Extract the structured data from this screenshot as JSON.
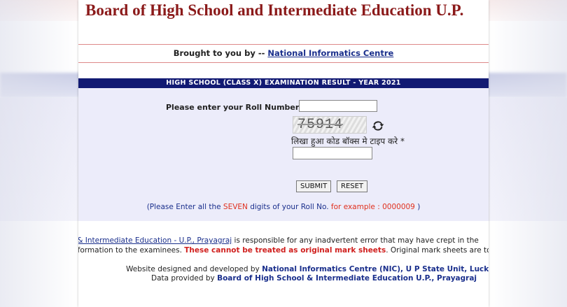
{
  "header": {
    "title": "Board of High School and Intermediate Education U.P."
  },
  "credit": {
    "prefix": "Brought to you by -- ",
    "link": "National Informatics Centre"
  },
  "banner": {
    "text": "HIGH SCHOOL (CLASS X)  EXAMINATION RESULT - YEAR 2021"
  },
  "form": {
    "roll_label": "Please enter your Roll Number",
    "roll_value": "",
    "captcha_code": "75914",
    "captcha_label": "लिखा हुआ कोड बॉक्स मे टाइप करे *",
    "captcha_value": "",
    "submit_label": "SUBMIT",
    "reset_label": "RESET"
  },
  "note": {
    "p1": "(Please Enter all the ",
    "p2": "SEVEN",
    "p3": " digits of your Roll No. ",
    "p4": "for example : 0000009",
    "p5": " )"
  },
  "disclaimer": {
    "line1_link": "l & Intermediate Education - U.P., Prayagraj",
    "line1_text": " is responsible for any inadvertent error that may have crept in the",
    "line2_a": "nformation to the examinees. ",
    "line2_red": "These cannot be treated as original mark sheets",
    "line2_b": ". Original mark sheets are to be"
  },
  "footer": {
    "line1_prefix": "Website designed and developed by ",
    "line1_bold": "National Informatics Centre (NIC), U P State Unit, Lucknow",
    "line2_prefix": "Data provided by ",
    "line2_bold": "Board of High School & Intermediate Education U.P., Prayagraj"
  },
  "colors": {
    "title": "#8b1a1a",
    "banner_bg": "#121a73",
    "form_bg": "#ececfa",
    "link": "#1a2f8c",
    "alert": "#e0301e"
  },
  "icons": {
    "refresh": "refresh-icon"
  }
}
